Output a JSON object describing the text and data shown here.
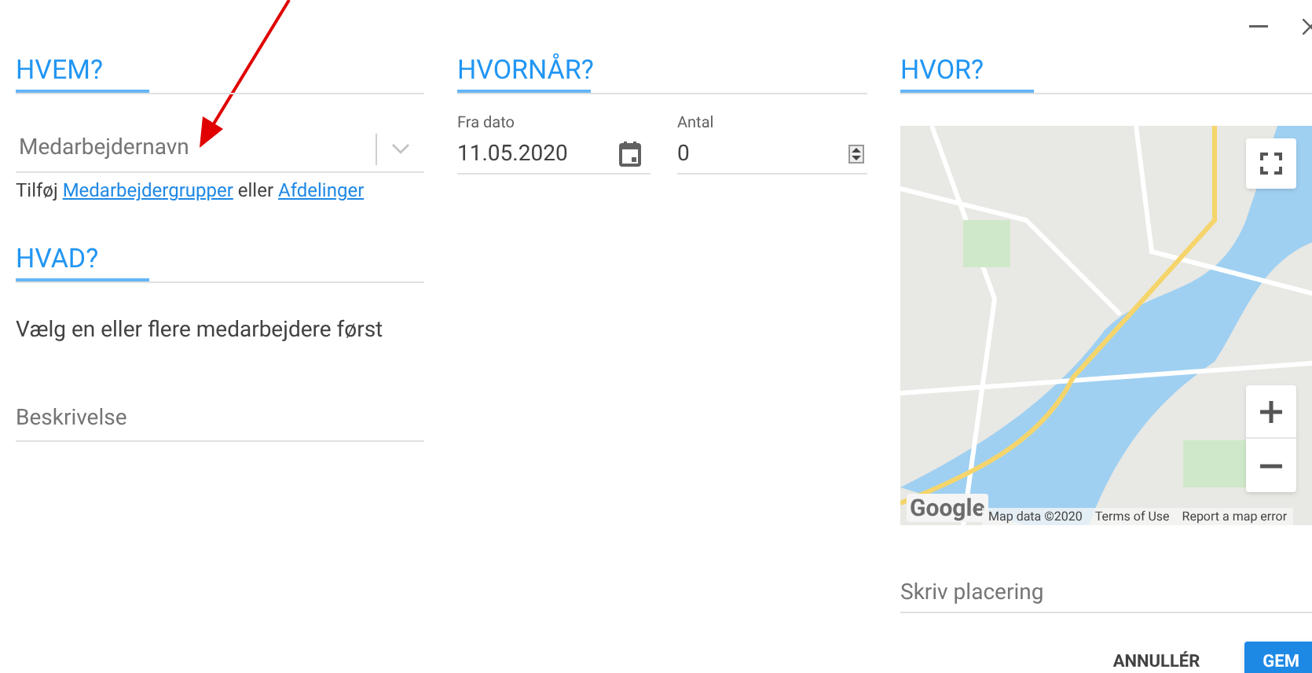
{
  "who": {
    "title": "HVEM?",
    "field": {
      "placeholder": "Medarbejdernavn"
    },
    "hint": [
      {
        "kind": "text",
        "text": "Tilføj"
      },
      {
        "kind": "link",
        "text": "Medarbejdergrupper"
      },
      {
        "kind": "text",
        "text": "eller"
      },
      {
        "kind": "link",
        "text": "Afdelinger"
      }
    ]
  },
  "what": {
    "title": "HVAD?",
    "message": "Vælg en eller flere medarbejdere først",
    "description": {
      "placeholder": "Beskrivelse"
    }
  },
  "when": {
    "title": "HVORNÅR?",
    "date": {
      "label": "Fra dato",
      "value": "11.05.2020"
    },
    "count": {
      "label": "Antal",
      "value": "0"
    }
  },
  "where": {
    "title": "HVOR?",
    "map": {
      "logo": "Google",
      "attribution": [
        "Map data ©2020",
        "Terms of Use",
        "Report a map error"
      ]
    },
    "location": {
      "placeholder": "Skriv placering"
    }
  },
  "buttons": [
    {
      "kind": "text",
      "label": "ANNULLÉR"
    },
    {
      "kind": "primary",
      "label": "GEM"
    }
  ]
}
